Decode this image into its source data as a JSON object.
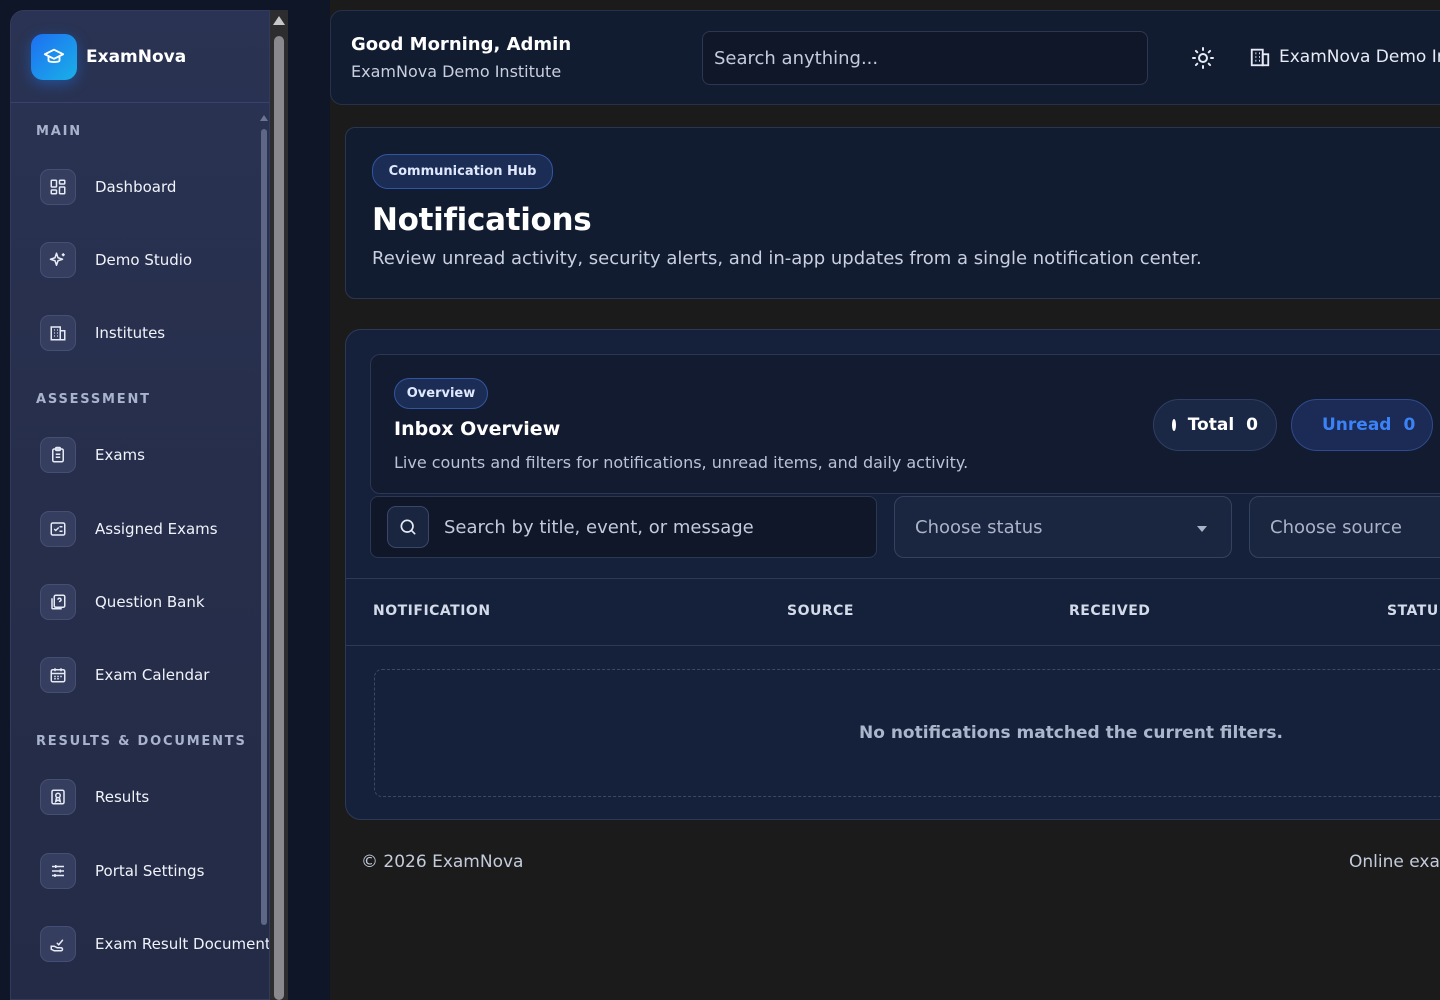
{
  "sidebar": {
    "brand": "ExamNova",
    "sections": {
      "main": "MAIN",
      "assessment": "ASSESSMENT",
      "results": "RESULTS & DOCUMENTS"
    },
    "items": {
      "dashboard": "Dashboard",
      "demo_studio": "Demo Studio",
      "institutes": "Institutes",
      "exams": "Exams",
      "assigned_exams": "Assigned Exams",
      "question_bank": "Question Bank",
      "exam_calendar": "Exam Calendar",
      "results": "Results",
      "portal_settings": "Portal Settings",
      "exam_result_documents": "Exam Result Document"
    }
  },
  "header": {
    "greeting": "Good Morning, Admin",
    "institute": "ExamNova Demo Institute",
    "search_placeholder": "Search anything...",
    "institute_switch": "ExamNova Demo In"
  },
  "hero": {
    "badge": "Communication Hub",
    "title": "Notifications",
    "description": "Review unread activity, security alerts, and in-app updates from a single notification center."
  },
  "overview": {
    "badge": "Overview",
    "title": "Inbox Overview",
    "description": "Live counts and filters for notifications, unread items, and daily activity.",
    "total_label": "Total",
    "total_value": "0",
    "unread_label": "Unread",
    "unread_value": "0"
  },
  "filters": {
    "search_placeholder": "Search by title, event, or message",
    "status_placeholder": "Choose status",
    "source_placeholder": "Choose source"
  },
  "table": {
    "columns": [
      "NOTIFICATION",
      "SOURCE",
      "RECEIVED",
      "STATU"
    ],
    "empty_message": "No notifications matched the current filters."
  },
  "footer": {
    "copyright": "© 2026 ExamNova",
    "tagline": "Online exar"
  },
  "colors": {
    "accent": "#3b82f6",
    "brand_gradient_start": "#1d6ff2",
    "brand_gradient_end": "#1ab0e8"
  }
}
